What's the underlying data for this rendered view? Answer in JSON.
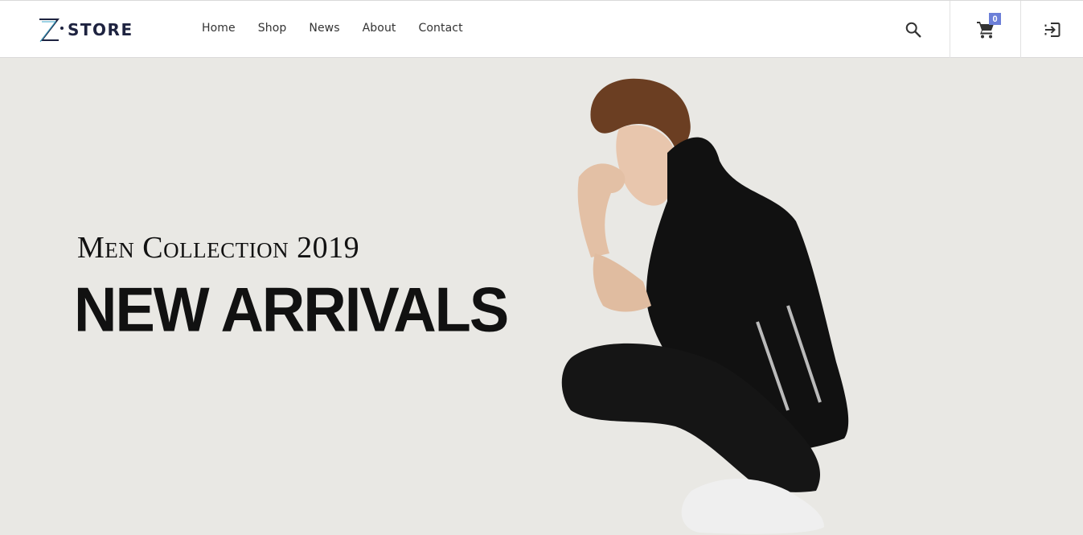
{
  "brand": {
    "name": "STORE",
    "mark": "Z"
  },
  "nav": {
    "items": [
      {
        "label": "Home"
      },
      {
        "label": "Shop"
      },
      {
        "label": "News"
      },
      {
        "label": "About"
      },
      {
        "label": "Contact"
      }
    ]
  },
  "actions": {
    "search_icon": "search-icon",
    "cart_icon": "cart-icon",
    "cart_count": "0",
    "login_icon": "sign-in-icon"
  },
  "hero": {
    "subtitle": "Men Collection 2019",
    "title": "NEW ARRIVALS"
  },
  "colors": {
    "hero_background": "#e9e8e4",
    "badge": "#6c7fd8",
    "brand_text": "#1e2340"
  }
}
